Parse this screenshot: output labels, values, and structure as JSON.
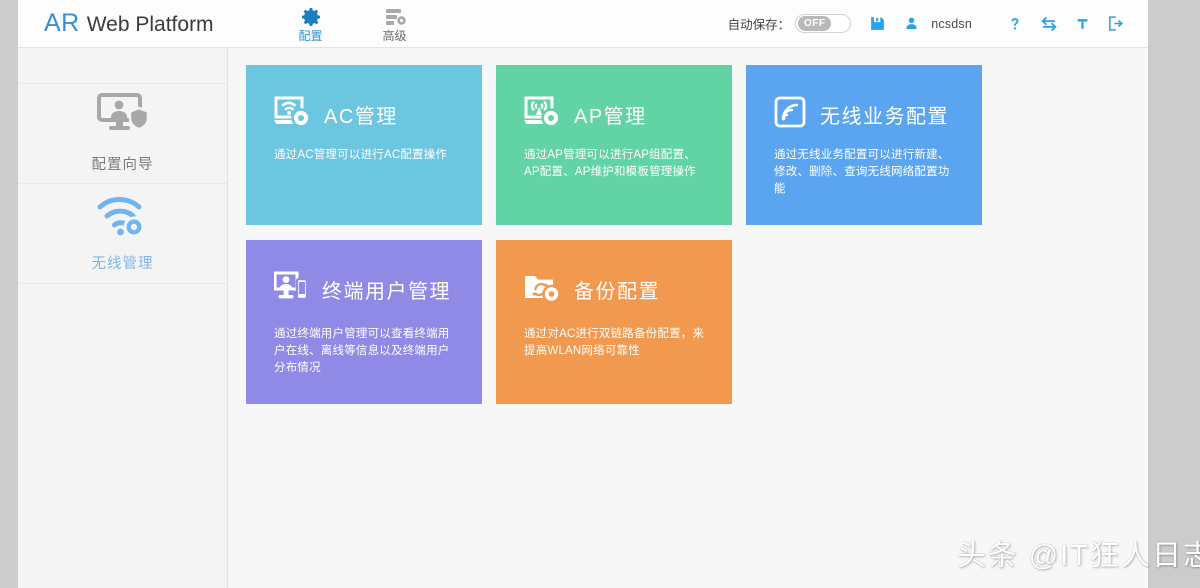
{
  "header": {
    "brand_prefix": "AR",
    "brand_suffix": "Web Platform",
    "tabs": [
      {
        "label": "配置",
        "icon": "gear-icon",
        "active": true
      },
      {
        "label": "高级",
        "icon": "advanced-server-icon",
        "active": false
      }
    ],
    "autosave_label": "自动保存：",
    "autosave_state": "OFF",
    "username": "ncsdsn",
    "icons": [
      "save-icon",
      "user-icon",
      "help-icon",
      "switch-icon",
      "tool-icon",
      "logout-icon"
    ],
    "accent_color": "#29a3e8",
    "brand_color": "#3a8fd4"
  },
  "sidebar": {
    "items": [
      {
        "label": "配置向导",
        "icon": "config-wizard-icon",
        "active": false,
        "color": "#7b7b7b"
      },
      {
        "label": "无线管理",
        "icon": "wireless-gear-icon",
        "active": true,
        "color": "#7fb7e8"
      }
    ]
  },
  "main": {
    "cards": [
      {
        "title": "AC管理",
        "desc": "通过AC管理可以进行AC配置操作",
        "color": "#6cc6e0",
        "icon": "ac-monitor-wifi-gear-icon"
      },
      {
        "title": "AP管理",
        "desc": "通过AP管理可以进行AP组配置、AP配置、AP维护和模板管理操作",
        "color": "#62d3a4",
        "icon": "ap-antenna-gear-icon"
      },
      {
        "title": "无线业务配置",
        "desc": "通过无线业务配置可以进行新建、修改、删除、查询无线网络配置功能",
        "color": "#5ba4ef",
        "icon": "wireless-signal-square-icon"
      },
      {
        "title": "终端用户管理",
        "desc": "通过终端用户管理可以查看终端用户在线、离线等信息以及终端用户分布情况",
        "color": "#8f8ae6",
        "icon": "terminal-user-icon"
      },
      {
        "title": "备份配置",
        "desc": "通过对AC进行双链路备份配置，来提高WLAN网络可靠性",
        "color": "#f0994f",
        "icon": "backup-folder-gear-icon"
      }
    ]
  },
  "watermark": {
    "text": "头条 @IT狂人日志"
  }
}
